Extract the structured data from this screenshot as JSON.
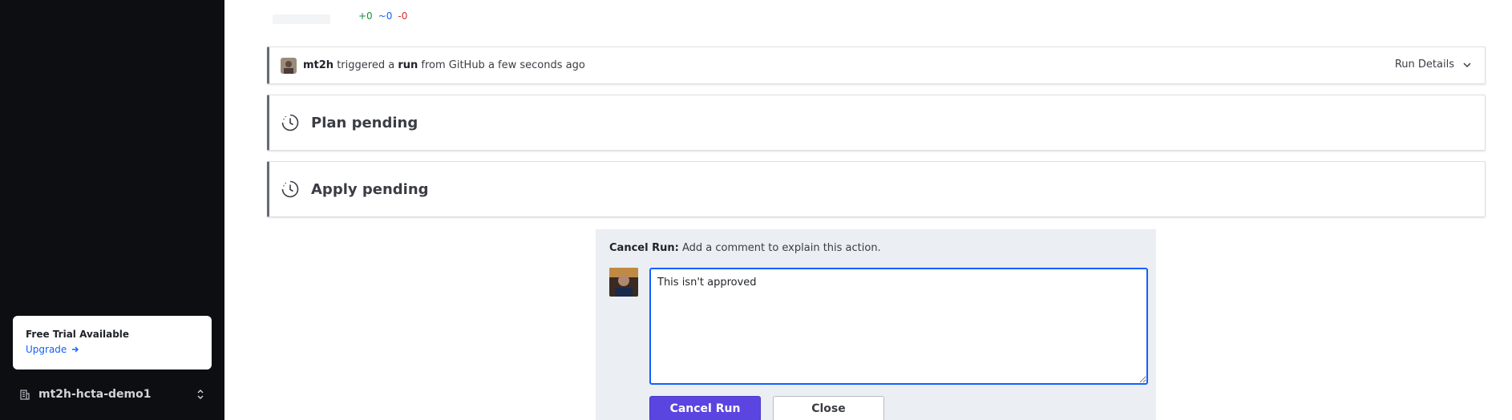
{
  "sidebar": {
    "trial": {
      "title": "Free Trial Available",
      "upgrade_label": "Upgrade"
    },
    "org": {
      "name": "mt2h-hcta-demo1"
    }
  },
  "diff": {
    "add": "+0",
    "change": "~0",
    "destroy": "-0"
  },
  "run": {
    "user": "mt2h",
    "text_mid": "triggered a",
    "run_word": "run",
    "text_end": "from GitHub a few seconds ago",
    "details_label": "Run Details"
  },
  "plan": {
    "label": "Plan pending"
  },
  "apply": {
    "label": "Apply pending"
  },
  "cancel_panel": {
    "header_bold": "Cancel Run:",
    "header_text": "Add a comment to explain this action.",
    "comment_value": "This isn't approved",
    "cancel_label": "Cancel Run",
    "close_label": "Close"
  },
  "colors": {
    "accent": "#5b45e0",
    "focus": "#1060ff",
    "sidebar_bg": "#0d0e12",
    "panel_bg": "#ebeef2"
  }
}
